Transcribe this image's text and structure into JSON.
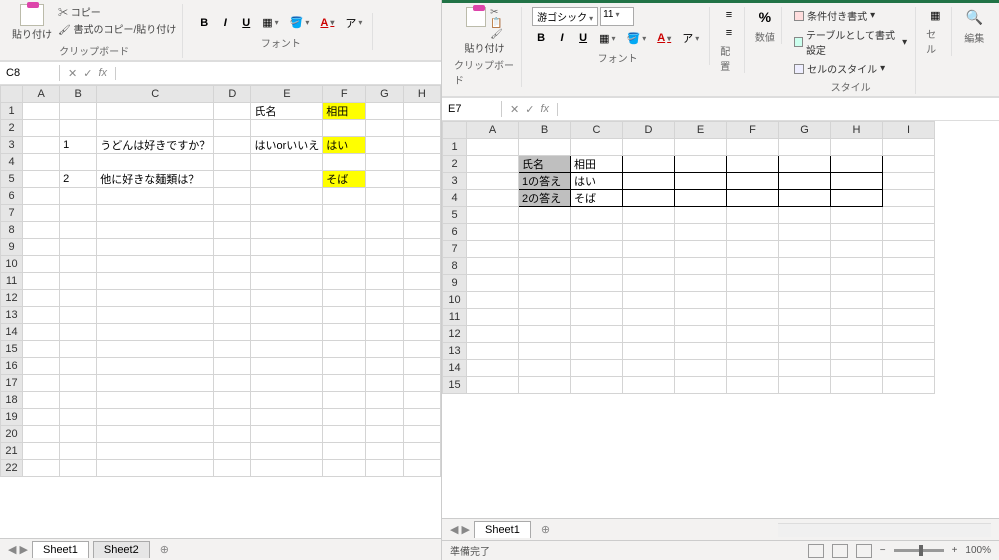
{
  "left": {
    "ribbon": {
      "paste": "貼り付け",
      "copy": "コピー",
      "format_painter": "書式のコピー/貼り付け",
      "clipboard_label": "クリップボード",
      "font_label": "フォント",
      "bold": "B",
      "italic": "I",
      "underline": "U",
      "font_color": "A"
    },
    "formula": {
      "cell_ref": "C8",
      "fx": "fx"
    },
    "columns": [
      "A",
      "B",
      "C",
      "D",
      "E",
      "F",
      "G",
      "H"
    ],
    "rowcount": 22,
    "data": {
      "r1": {
        "E": "氏名",
        "F": "相田"
      },
      "r3": {
        "B": "1",
        "C": "うどんは好きですか？",
        "E": "はいorいいえ",
        "F": "はい"
      },
      "r5": {
        "B": "2",
        "C": "他に好きな麺類は？",
        "F": "そば"
      }
    },
    "tabs": [
      "Sheet1",
      "Sheet2"
    ]
  },
  "right": {
    "ribbon": {
      "paste": "貼り付け",
      "clipboard_label": "クリップボード",
      "font_name": "游ゴシック",
      "font_size": "11",
      "bold": "B",
      "italic": "I",
      "underline": "U",
      "font_color": "A",
      "font_label": "フォント",
      "align_label": "配置",
      "number_label": "数値",
      "pct": "%",
      "cond_format": "条件付き書式",
      "as_table": "テーブルとして書式設定",
      "cell_styles": "セルのスタイル",
      "styles_label": "スタイル",
      "cells_label": "セル",
      "editing_label": "編集"
    },
    "formula": {
      "cell_ref": "E7",
      "fx": "fx"
    },
    "columns": [
      "A",
      "B",
      "C",
      "D",
      "E",
      "F",
      "G",
      "H",
      "I"
    ],
    "rowcount": 15,
    "data": {
      "r2": {
        "B": "氏名",
        "C": "相田"
      },
      "r3": {
        "B": "1の答え",
        "C": "はい"
      },
      "r4": {
        "B": "2の答え",
        "C": "そば"
      }
    },
    "tabs": [
      "Sheet1"
    ],
    "status": "準備完了",
    "zoom": "100%"
  }
}
